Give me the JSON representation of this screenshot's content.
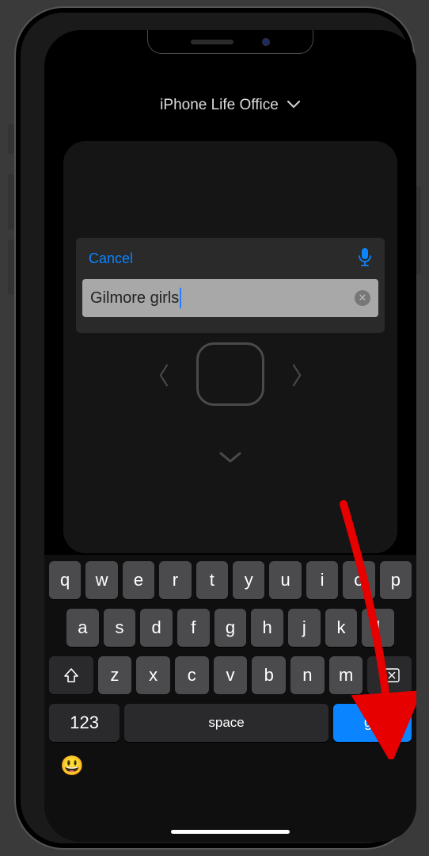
{
  "header": {
    "title": "iPhone Life Office"
  },
  "search": {
    "cancel_label": "Cancel",
    "input_value": "Gilmore girls",
    "clear_glyph": "✕"
  },
  "keyboard": {
    "row1": [
      "q",
      "w",
      "e",
      "r",
      "t",
      "y",
      "u",
      "i",
      "o",
      "p"
    ],
    "row2": [
      "a",
      "s",
      "d",
      "f",
      "g",
      "h",
      "j",
      "k",
      "l"
    ],
    "row3": [
      "z",
      "x",
      "c",
      "v",
      "b",
      "n",
      "m"
    ],
    "num_label": "123",
    "space_label": "space",
    "go_label": "go"
  },
  "emoji_glyph": "😃",
  "annotation": {
    "color": "#e60000"
  }
}
